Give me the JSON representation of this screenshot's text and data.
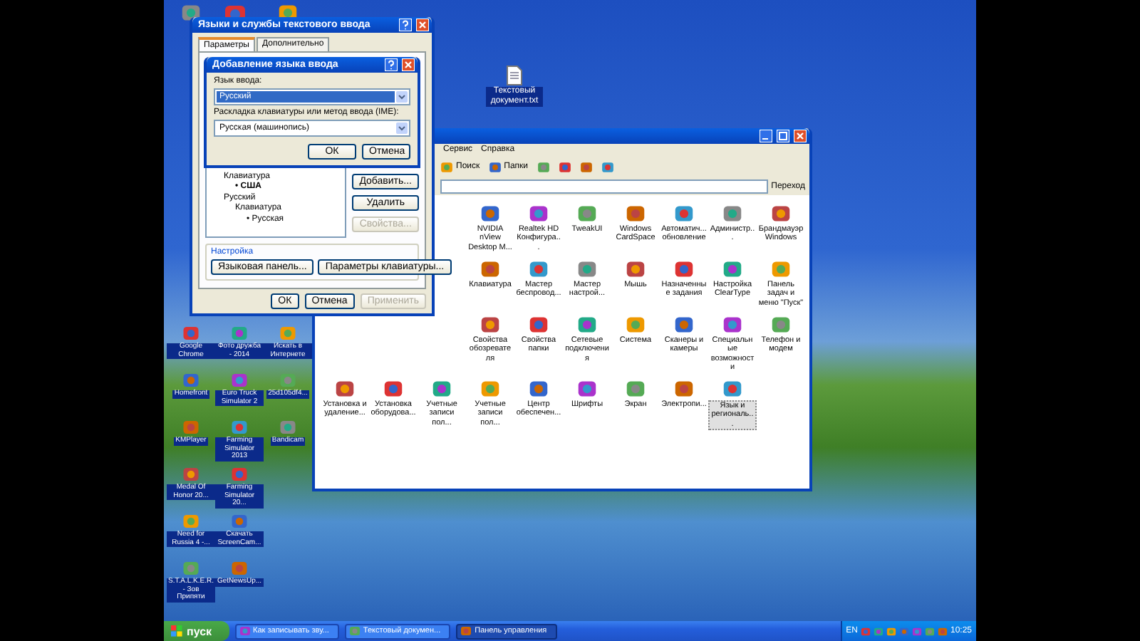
{
  "desktop_top_file": {
    "label": "Текстовый документ.txt"
  },
  "desktop_icons": [
    [
      {
        "label": "Google Chrome"
      },
      {
        "label": "Фото дружба - 2014"
      },
      {
        "label": "Искать в Интернете"
      }
    ],
    [
      {
        "label": "Homefront"
      },
      {
        "label": "Euro Truck Simulator 2"
      },
      {
        "label": "25d105df4..."
      }
    ],
    [
      {
        "label": "KMPlayer"
      },
      {
        "label": "Farming Simulator 2013"
      },
      {
        "label": "Bandicam"
      }
    ],
    [
      {
        "label": "Medal Of Honor 20..."
      },
      {
        "label": "Farming Simulator 20..."
      }
    ],
    [
      {
        "label": "Need for Russia 4 -..."
      },
      {
        "label": "Скачать ScreenCam..."
      }
    ],
    [
      {
        "label": "S.T.A.L.K.E.R. - Зов Припяти"
      },
      {
        "label": "GetNewsUp..."
      }
    ]
  ],
  "control_panel": {
    "menu": [
      "Сервис",
      "Справка"
    ],
    "toolbar": [
      "Поиск",
      "Папки"
    ],
    "go_button": "Переход",
    "rows": [
      [
        null,
        null,
        null,
        {
          "label": "NVIDIA nView Desktop M...",
          "selected": false
        },
        {
          "label": "Realtek HD Конфигура...",
          "selected": false
        },
        {
          "label": "TweakUI",
          "selected": false
        },
        {
          "label": "Windows CardSpace",
          "selected": false
        },
        {
          "label": "Автоматич... обновление",
          "selected": false
        },
        {
          "label": "Администр...",
          "selected": false
        },
        {
          "label": "Брандмауэр Windows",
          "selected": false
        }
      ],
      [
        null,
        null,
        null,
        {
          "label": "Клавиатура",
          "selected": false
        },
        {
          "label": "Мастер беспровод...",
          "selected": false
        },
        {
          "label": "Мастер настрой...",
          "selected": false
        },
        {
          "label": "Мышь",
          "selected": false
        },
        {
          "label": "Назначенные задания",
          "selected": false
        },
        {
          "label": "Настройка ClearType",
          "selected": false
        },
        {
          "label": "Панель задач и меню \"Пуск\"",
          "selected": false
        }
      ],
      [
        null,
        null,
        null,
        {
          "label": "Свойства обозревателя",
          "selected": false
        },
        {
          "label": "Свойства папки",
          "selected": false
        },
        {
          "label": "Сетевые подключения",
          "selected": false
        },
        {
          "label": "Система",
          "selected": false
        },
        {
          "label": "Сканеры и камеры",
          "selected": false
        },
        {
          "label": "Специальные возможности",
          "selected": false
        },
        {
          "label": "Телефон и модем",
          "selected": false
        }
      ],
      [
        {
          "label": "Установка и удаление...",
          "selected": false
        },
        {
          "label": "Установка оборудова...",
          "selected": false
        },
        {
          "label": "Учетные записи пол...",
          "selected": false
        },
        {
          "label": "Учетные записи пол...",
          "selected": false
        },
        {
          "label": "Центр обеспечен...",
          "selected": false
        },
        {
          "label": "Шрифты",
          "selected": false
        },
        {
          "label": "Экран",
          "selected": false
        },
        {
          "label": "Электропи...",
          "selected": false
        },
        {
          "label": "Язык и региональ...",
          "selected": true
        }
      ]
    ]
  },
  "lang_dialog": {
    "title": "Языки и службы текстового ввода",
    "tabs": [
      {
        "label": "Параметры",
        "selected": true
      },
      {
        "label": "Дополнительно",
        "selected": false
      }
    ],
    "tree": [
      {
        "label": "Клавиатура",
        "default": false,
        "children": [
          {
            "label": "• США",
            "default": true
          }
        ]
      },
      {
        "label": "Русский",
        "default": false,
        "children": [
          {
            "label": "Клавиатура",
            "default": false,
            "children": [
              {
                "label": "• Русская",
                "default": false
              }
            ]
          }
        ]
      }
    ],
    "side_buttons": [
      {
        "label": "Добавить...",
        "disabled": false
      },
      {
        "label": "Удалить",
        "disabled": false
      },
      {
        "label": "Свойства...",
        "disabled": true
      }
    ],
    "settings_title": "Настройка",
    "settings_buttons": [
      {
        "label": "Языковая панель...",
        "disabled": false
      },
      {
        "label": "Параметры клавиатуры...",
        "disabled": false
      }
    ],
    "footer_buttons": [
      {
        "label": "ОК",
        "disabled": false
      },
      {
        "label": "Отмена",
        "disabled": false
      },
      {
        "label": "Применить",
        "disabled": true
      }
    ]
  },
  "add_dialog": {
    "title": "Добавление языка ввода",
    "language_label": "Язык ввода:",
    "language": "Русский",
    "layout_label": "Раскладка клавиатуры или метод ввода (IME):",
    "layout": "Русская (машинопись)",
    "buttons": [
      "ОК",
      "Отмена"
    ]
  },
  "taskbar": {
    "start": "пуск",
    "tasks": [
      {
        "label": "Как записывать зву...",
        "selected": false
      },
      {
        "label": "Текстовый докумен...",
        "selected": false
      },
      {
        "label": "Панель управления",
        "selected": true
      }
    ],
    "language": "EN",
    "clock": "10:25"
  }
}
